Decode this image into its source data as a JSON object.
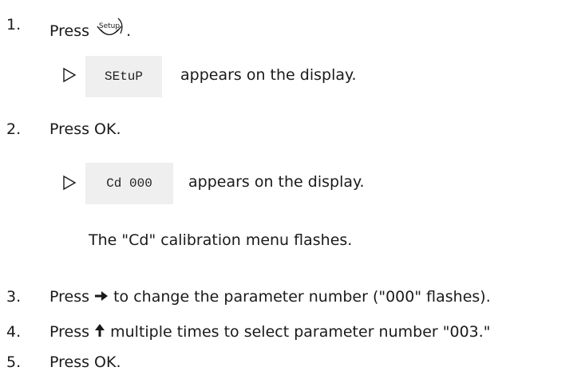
{
  "steps": [
    {
      "number": "1.",
      "pre": "Press",
      "post": ".",
      "icon": "setup-key-icon",
      "icon_label": "Setup"
    },
    {
      "number": "2.",
      "text": "Press OK."
    },
    {
      "number": "3.",
      "pre": "Press",
      "post": "to change the parameter number (\"000\" flashes).",
      "icon": "right-arrow-icon"
    },
    {
      "number": "4.",
      "pre": "Press",
      "post": "multiple times to select parameter number \"003.\"",
      "icon": "up-arrow-icon"
    },
    {
      "number": "5.",
      "text": "Press OK."
    }
  ],
  "results": [
    {
      "display": "SEtuP",
      "text": "appears on the display."
    },
    {
      "display": "Cd 000",
      "text": "appears on the display."
    }
  ],
  "note": "The \"Cd\" calibration menu flashes.",
  "icons": {
    "result_marker": "result-triangle-icon"
  }
}
